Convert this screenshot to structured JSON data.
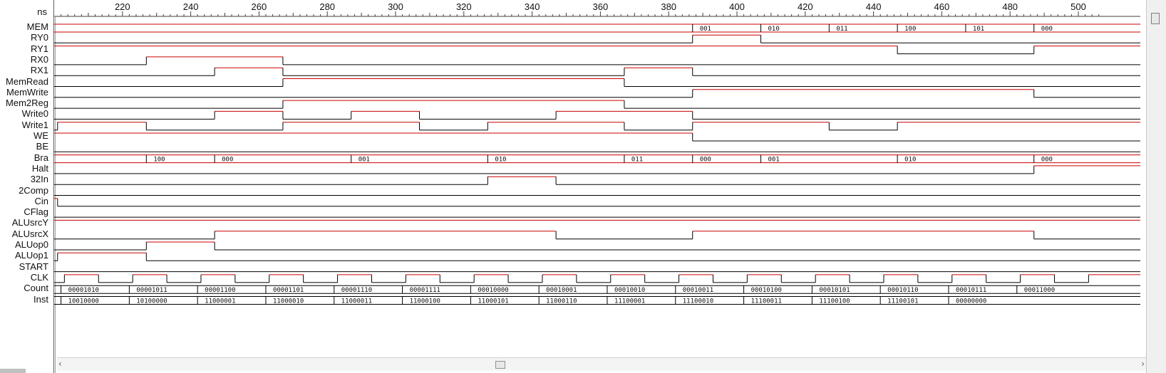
{
  "time_unit": "ns",
  "time_ticks": [
    "220",
    "240",
    "260",
    "280",
    "300",
    "320",
    "340",
    "360",
    "380",
    "400",
    "420",
    "440",
    "460",
    "480",
    "500"
  ],
  "signals": [
    {
      "name": "MEM",
      "kind": "bus",
      "color": "#cc0000",
      "segments": [
        {
          "t": 200,
          "label": ""
        },
        {
          "t": 387,
          "label": "001"
        },
        {
          "t": 407,
          "label": "010"
        },
        {
          "t": 427,
          "label": "011"
        },
        {
          "t": 447,
          "label": "100"
        },
        {
          "t": 467,
          "label": "101"
        },
        {
          "t": 487,
          "label": "000"
        }
      ]
    },
    {
      "name": "RY0",
      "kind": "bit",
      "initial": 0,
      "changes": [
        387,
        407
      ]
    },
    {
      "name": "RY1",
      "kind": "bit",
      "initial": 1,
      "changes": [
        447,
        487
      ]
    },
    {
      "name": "RX0",
      "kind": "bit",
      "initial": 0,
      "changes": [
        227,
        267
      ]
    },
    {
      "name": "RX1",
      "kind": "bit",
      "initial": 0,
      "changes": [
        247,
        267,
        367,
        387
      ]
    },
    {
      "name": "MemRead",
      "kind": "bit",
      "initial": 0,
      "changes": [
        267,
        367
      ]
    },
    {
      "name": "MemWrite",
      "kind": "bit",
      "initial": 0,
      "changes": [
        387,
        487
      ]
    },
    {
      "name": "Mem2Reg",
      "kind": "bit",
      "initial": 0,
      "changes": [
        267,
        367
      ]
    },
    {
      "name": "Write0",
      "kind": "bit",
      "initial": 0,
      "changes": [
        247,
        267,
        287,
        307,
        347,
        387
      ]
    },
    {
      "name": "Write1",
      "kind": "bit",
      "initial": 0,
      "changes": [
        201,
        227,
        267,
        307,
        327,
        367,
        387,
        427,
        447
      ]
    },
    {
      "name": "WE",
      "kind": "bit",
      "initial": 1,
      "changes": [
        387
      ]
    },
    {
      "name": "BE",
      "kind": "bit",
      "initial": 0,
      "changes": []
    },
    {
      "name": "Bra",
      "kind": "bus",
      "color": "#cc0000",
      "segments": [
        {
          "t": 200,
          "label": ""
        },
        {
          "t": 227,
          "label": "100"
        },
        {
          "t": 247,
          "label": "000"
        },
        {
          "t": 287,
          "label": "001"
        },
        {
          "t": 327,
          "label": "010"
        },
        {
          "t": 367,
          "label": "011"
        },
        {
          "t": 387,
          "label": "000"
        },
        {
          "t": 407,
          "label": "001"
        },
        {
          "t": 447,
          "label": "010"
        },
        {
          "t": 487,
          "label": "000"
        }
      ]
    },
    {
      "name": "Halt",
      "kind": "bit",
      "initial": 0,
      "changes": [
        487
      ]
    },
    {
      "name": "32In",
      "kind": "bit",
      "initial": 0,
      "changes": [
        327,
        347
      ]
    },
    {
      "name": "2Comp",
      "kind": "bit",
      "initial": 0,
      "changes": []
    },
    {
      "name": "Cin",
      "kind": "bit",
      "initial": 1,
      "changes": [
        201
      ]
    },
    {
      "name": "CFlag",
      "kind": "bit",
      "initial": 0,
      "changes": []
    },
    {
      "name": "ALUsrcY",
      "kind": "bit",
      "initial": 1,
      "changes": []
    },
    {
      "name": "ALUsrcX",
      "kind": "bit",
      "initial": 0,
      "changes": [
        247,
        347,
        387,
        487
      ]
    },
    {
      "name": "ALUop0",
      "kind": "bit",
      "initial": 0,
      "changes": [
        227,
        247
      ]
    },
    {
      "name": "ALUop1",
      "kind": "bit",
      "initial": 0,
      "changes": [
        201,
        227
      ]
    },
    {
      "name": "START",
      "kind": "bit",
      "initial": 0,
      "changes": []
    },
    {
      "name": "CLK",
      "kind": "clock",
      "first_rise": 203,
      "half_period": 10
    },
    {
      "name": "Count",
      "kind": "bus",
      "color": "#000000",
      "segments": [
        {
          "t": 202,
          "label": "00001010"
        },
        {
          "t": 222,
          "label": "00001011"
        },
        {
          "t": 242,
          "label": "00001100"
        },
        {
          "t": 262,
          "label": "00001101"
        },
        {
          "t": 282,
          "label": "00001110"
        },
        {
          "t": 302,
          "label": "00001111"
        },
        {
          "t": 322,
          "label": "00010000"
        },
        {
          "t": 342,
          "label": "00010001"
        },
        {
          "t": 362,
          "label": "00010010"
        },
        {
          "t": 382,
          "label": "00010011"
        },
        {
          "t": 402,
          "label": "00010100"
        },
        {
          "t": 422,
          "label": "00010101"
        },
        {
          "t": 442,
          "label": "00010110"
        },
        {
          "t": 462,
          "label": "00010111"
        },
        {
          "t": 482,
          "label": "00011000"
        }
      ]
    },
    {
      "name": "Inst",
      "kind": "bus",
      "color": "#000000",
      "segments": [
        {
          "t": 202,
          "label": "10010000"
        },
        {
          "t": 222,
          "label": "10100000"
        },
        {
          "t": 242,
          "label": "11000001"
        },
        {
          "t": 262,
          "label": "11000010"
        },
        {
          "t": 282,
          "label": "11000011"
        },
        {
          "t": 302,
          "label": "11000100"
        },
        {
          "t": 322,
          "label": "11000101"
        },
        {
          "t": 342,
          "label": "11000110"
        },
        {
          "t": 362,
          "label": "11100001"
        },
        {
          "t": 382,
          "label": "11100010"
        },
        {
          "t": 402,
          "label": "11100011"
        },
        {
          "t": 422,
          "label": "11100100"
        },
        {
          "t": 442,
          "label": "11100101"
        },
        {
          "t": 462,
          "label": "00000000"
        }
      ]
    }
  ]
}
